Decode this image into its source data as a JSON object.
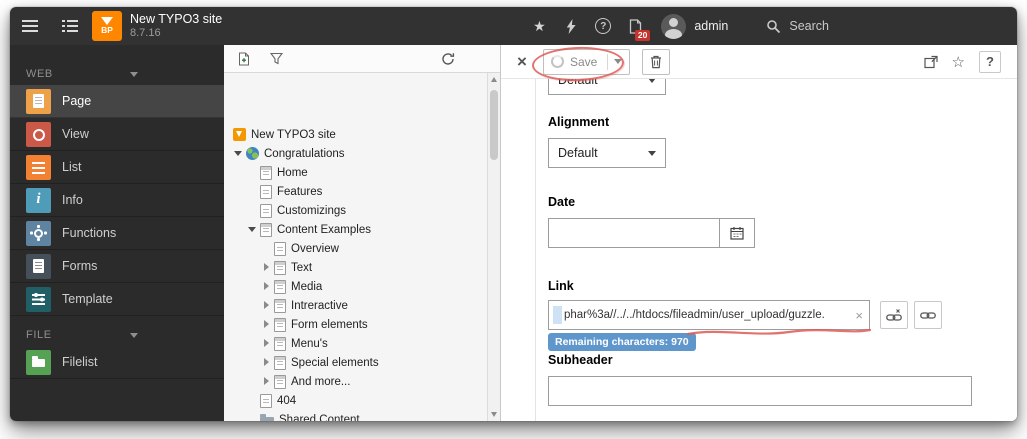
{
  "topbar": {
    "logo_badge": "BP",
    "site_title": "New TYPO3 site",
    "version": "8.7.16",
    "opendocs_count": "20",
    "username": "admin",
    "search_label": "Search"
  },
  "module_menu": {
    "sections": [
      {
        "label": "WEB",
        "items": [
          {
            "label": "Page",
            "color": "#eda24a",
            "active": true
          },
          {
            "label": "View",
            "color": "#cc5948"
          },
          {
            "label": "List",
            "color": "#f28133"
          },
          {
            "label": "Info",
            "color": "#4f9cb8"
          },
          {
            "label": "Functions",
            "color": "#5f84a2"
          },
          {
            "label": "Forms",
            "color": "#46505a"
          },
          {
            "label": "Template",
            "color": "#215f67"
          }
        ]
      },
      {
        "label": "FILE",
        "items": [
          {
            "label": "Filelist",
            "color": "#55a255"
          }
        ]
      }
    ]
  },
  "page_tree": {
    "nodes": [
      {
        "label": "New TYPO3 site"
      },
      {
        "label": "Congratulations"
      },
      {
        "label": "Home"
      },
      {
        "label": "Features"
      },
      {
        "label": "Customizings"
      },
      {
        "label": "Content Examples"
      },
      {
        "label": "Overview"
      },
      {
        "label": "Text"
      },
      {
        "label": "Media"
      },
      {
        "label": "Intreractive"
      },
      {
        "label": "Form elements"
      },
      {
        "label": "Menu's"
      },
      {
        "label": "Special elements"
      },
      {
        "label": "And more..."
      },
      {
        "label": "404"
      },
      {
        "label": "Shared Content"
      }
    ]
  },
  "docheader": {
    "save_label": "Save"
  },
  "form": {
    "top_select_value": "Default",
    "alignment_label": "Alignment",
    "alignment_value": "Default",
    "date_label": "Date",
    "link_label": "Link",
    "link_value": "phar%3a//../../htdocs/fileadmin/user_upload/guzzle.",
    "char_tooltip": "Remaining characters: 970",
    "subheader_label": "Subheader"
  },
  "icons": {
    "star": "★",
    "bookmark_star": "☆",
    "help": "?",
    "close": "×",
    "clear": "×"
  },
  "colors": {
    "topbar_bg": "#323232",
    "menu_bg": "#2b2b2b",
    "logo_orange": "#ff8700",
    "badge_red": "#c8332e",
    "tooltip_blue": "#5f97cc",
    "annotation_red": "#dd5a55"
  }
}
